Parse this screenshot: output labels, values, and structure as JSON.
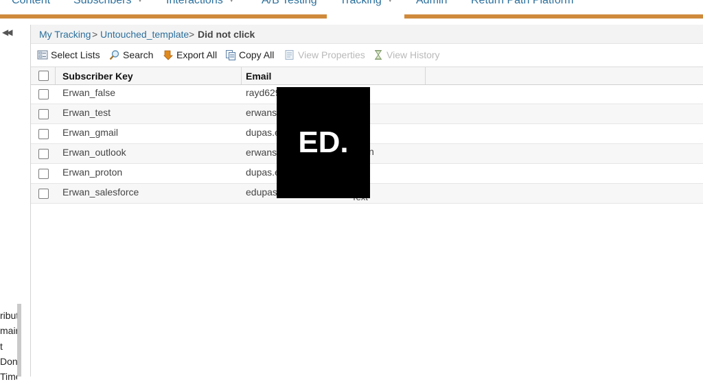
{
  "nav": {
    "tabs": [
      {
        "label": "Content"
      },
      {
        "label": "Subscribers"
      },
      {
        "label": "Interactions"
      },
      {
        "label": "A/B Testing"
      },
      {
        "label": "Tracking"
      },
      {
        "label": "Admin"
      },
      {
        "label": "Return Path Platform"
      }
    ],
    "accent_color": "#cf8a3c"
  },
  "side_panel": {
    "partial_items": [
      "ribut",
      "mair",
      "t",
      "Don",
      "Time"
    ]
  },
  "breadcrumb": {
    "items": [
      "My Tracking",
      "Untouched_template"
    ],
    "separator": ">",
    "current": "Did not click"
  },
  "toolbar": {
    "select_lists": "Select Lists",
    "search": "Search",
    "export_all": "Export All",
    "copy_all": "Copy All",
    "view_properties": "View Properties",
    "view_history": "View History"
  },
  "table": {
    "columns": [
      "Subscriber Key",
      "Email"
    ],
    "rows": [
      {
        "key": "Erwan_false",
        "email": "rayd629"
      },
      {
        "key": "Erwan_test",
        "email": "erwans"
      },
      {
        "key": "Erwan_gmail",
        "email": "dupas.e"
      },
      {
        "key": "Erwan_outlook",
        "email": "erwans"
      },
      {
        "key": "Erwan_proton",
        "email": "dupas.e"
      },
      {
        "key": "Erwan_salesforce",
        "email": "edupas"
      }
    ]
  },
  "overlay": {
    "logo_text": "ED.",
    "peek_char": "n",
    "peek_text": "Text"
  }
}
